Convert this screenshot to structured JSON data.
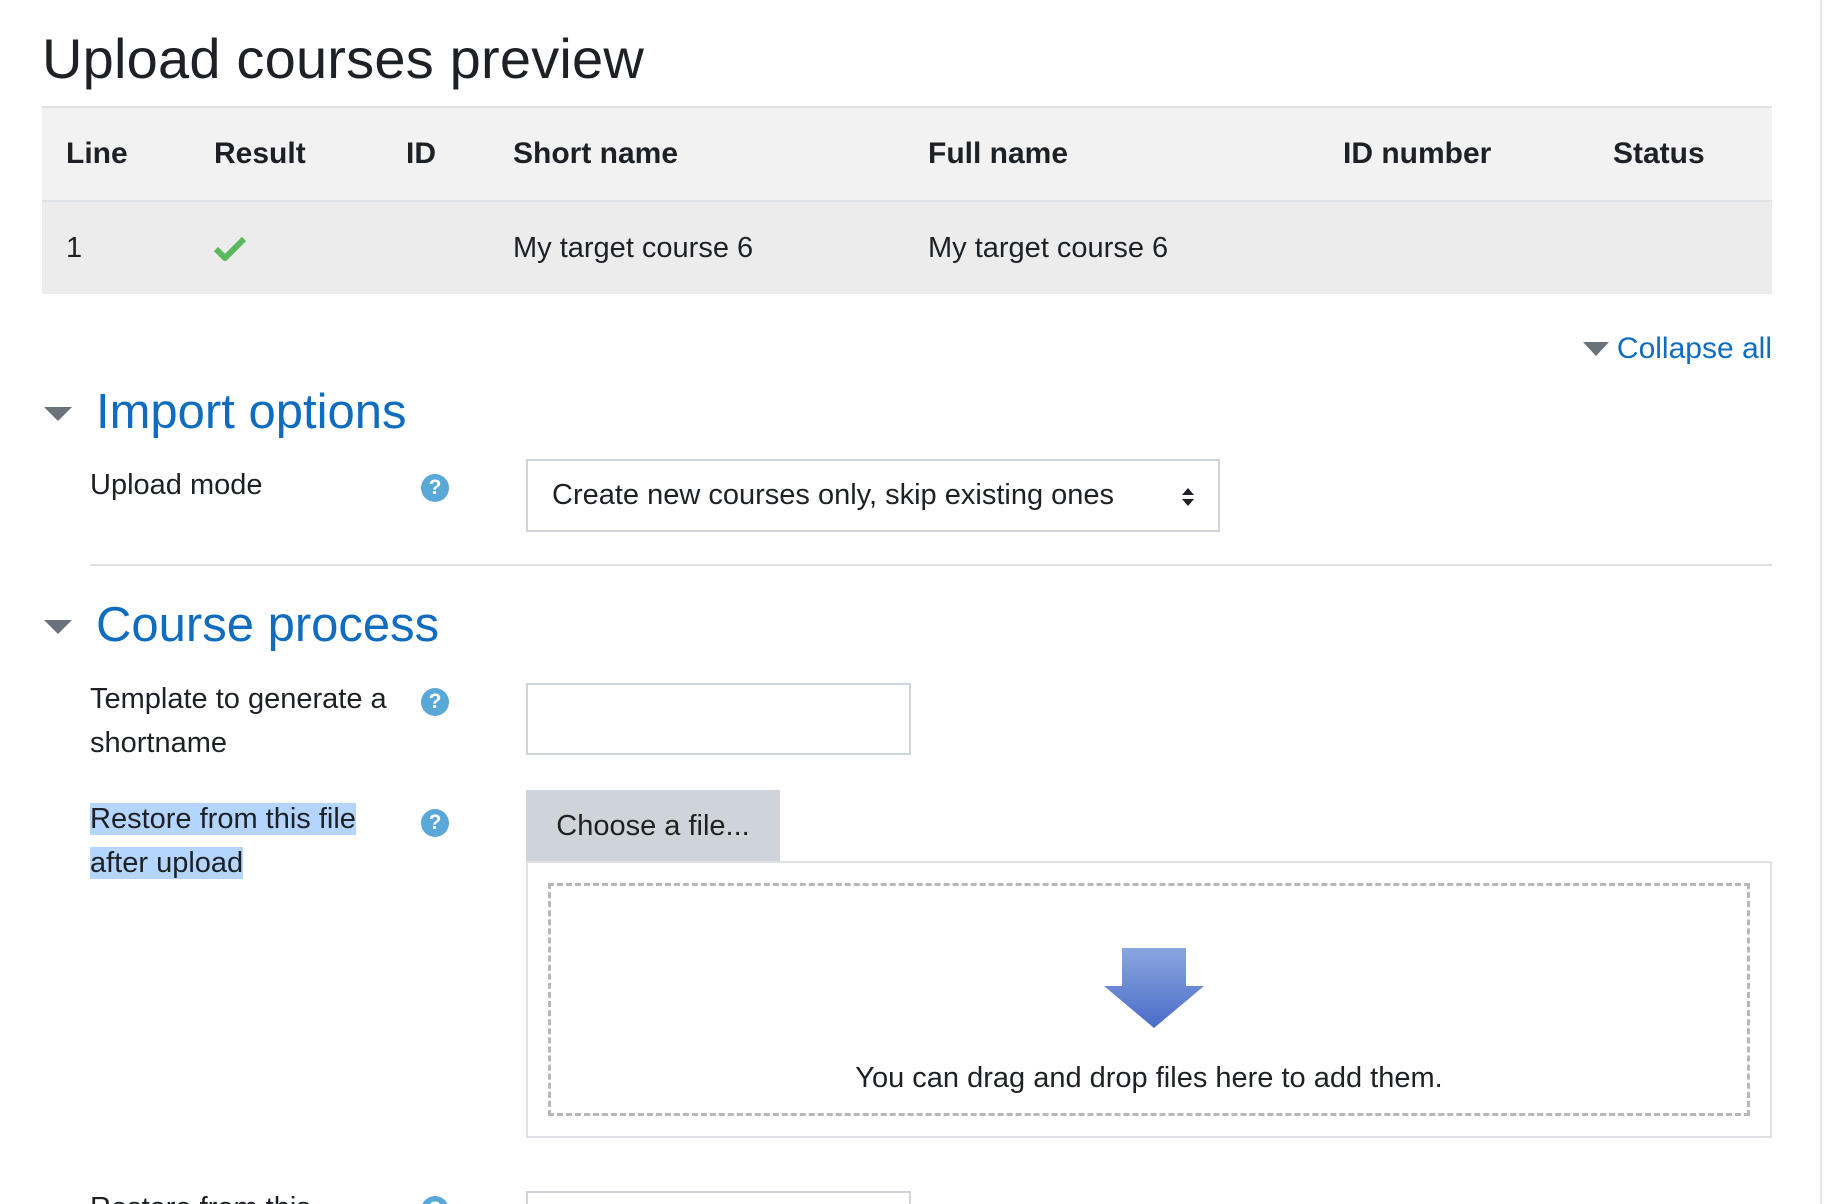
{
  "page": {
    "title": "Upload courses preview"
  },
  "table": {
    "headers": [
      "Line",
      "Result",
      "ID",
      "Short name",
      "Full name",
      "ID number",
      "Status"
    ],
    "rows": [
      {
        "line": "1",
        "result": "check-icon",
        "id": "",
        "shortname": "My target course 6",
        "fullname": "My target course 6",
        "idnumber": "",
        "status": ""
      }
    ]
  },
  "collapse_all": {
    "label": "Collapse all"
  },
  "sections": {
    "import_options": {
      "title": "Import options",
      "upload_mode": {
        "label": "Upload mode",
        "selected": "Create new courses only, skip existing ones"
      }
    },
    "course_process": {
      "title": "Course process",
      "template": {
        "label_line1": "Template to generate a",
        "label_line2": "shortname",
        "value": ""
      },
      "restore_file": {
        "label_line1": "Restore from this file",
        "label_line2": "after upload",
        "choose_button": "Choose a file...",
        "drop_text": "You can drag and drop files here to add them."
      },
      "restore_course": {
        "label_line1": "Restore from this"
      }
    }
  },
  "colors": {
    "link": "#0f6cbf",
    "success": "#5cb85c",
    "help": "#5aa8d7",
    "highlight": "#b4d5fe"
  }
}
